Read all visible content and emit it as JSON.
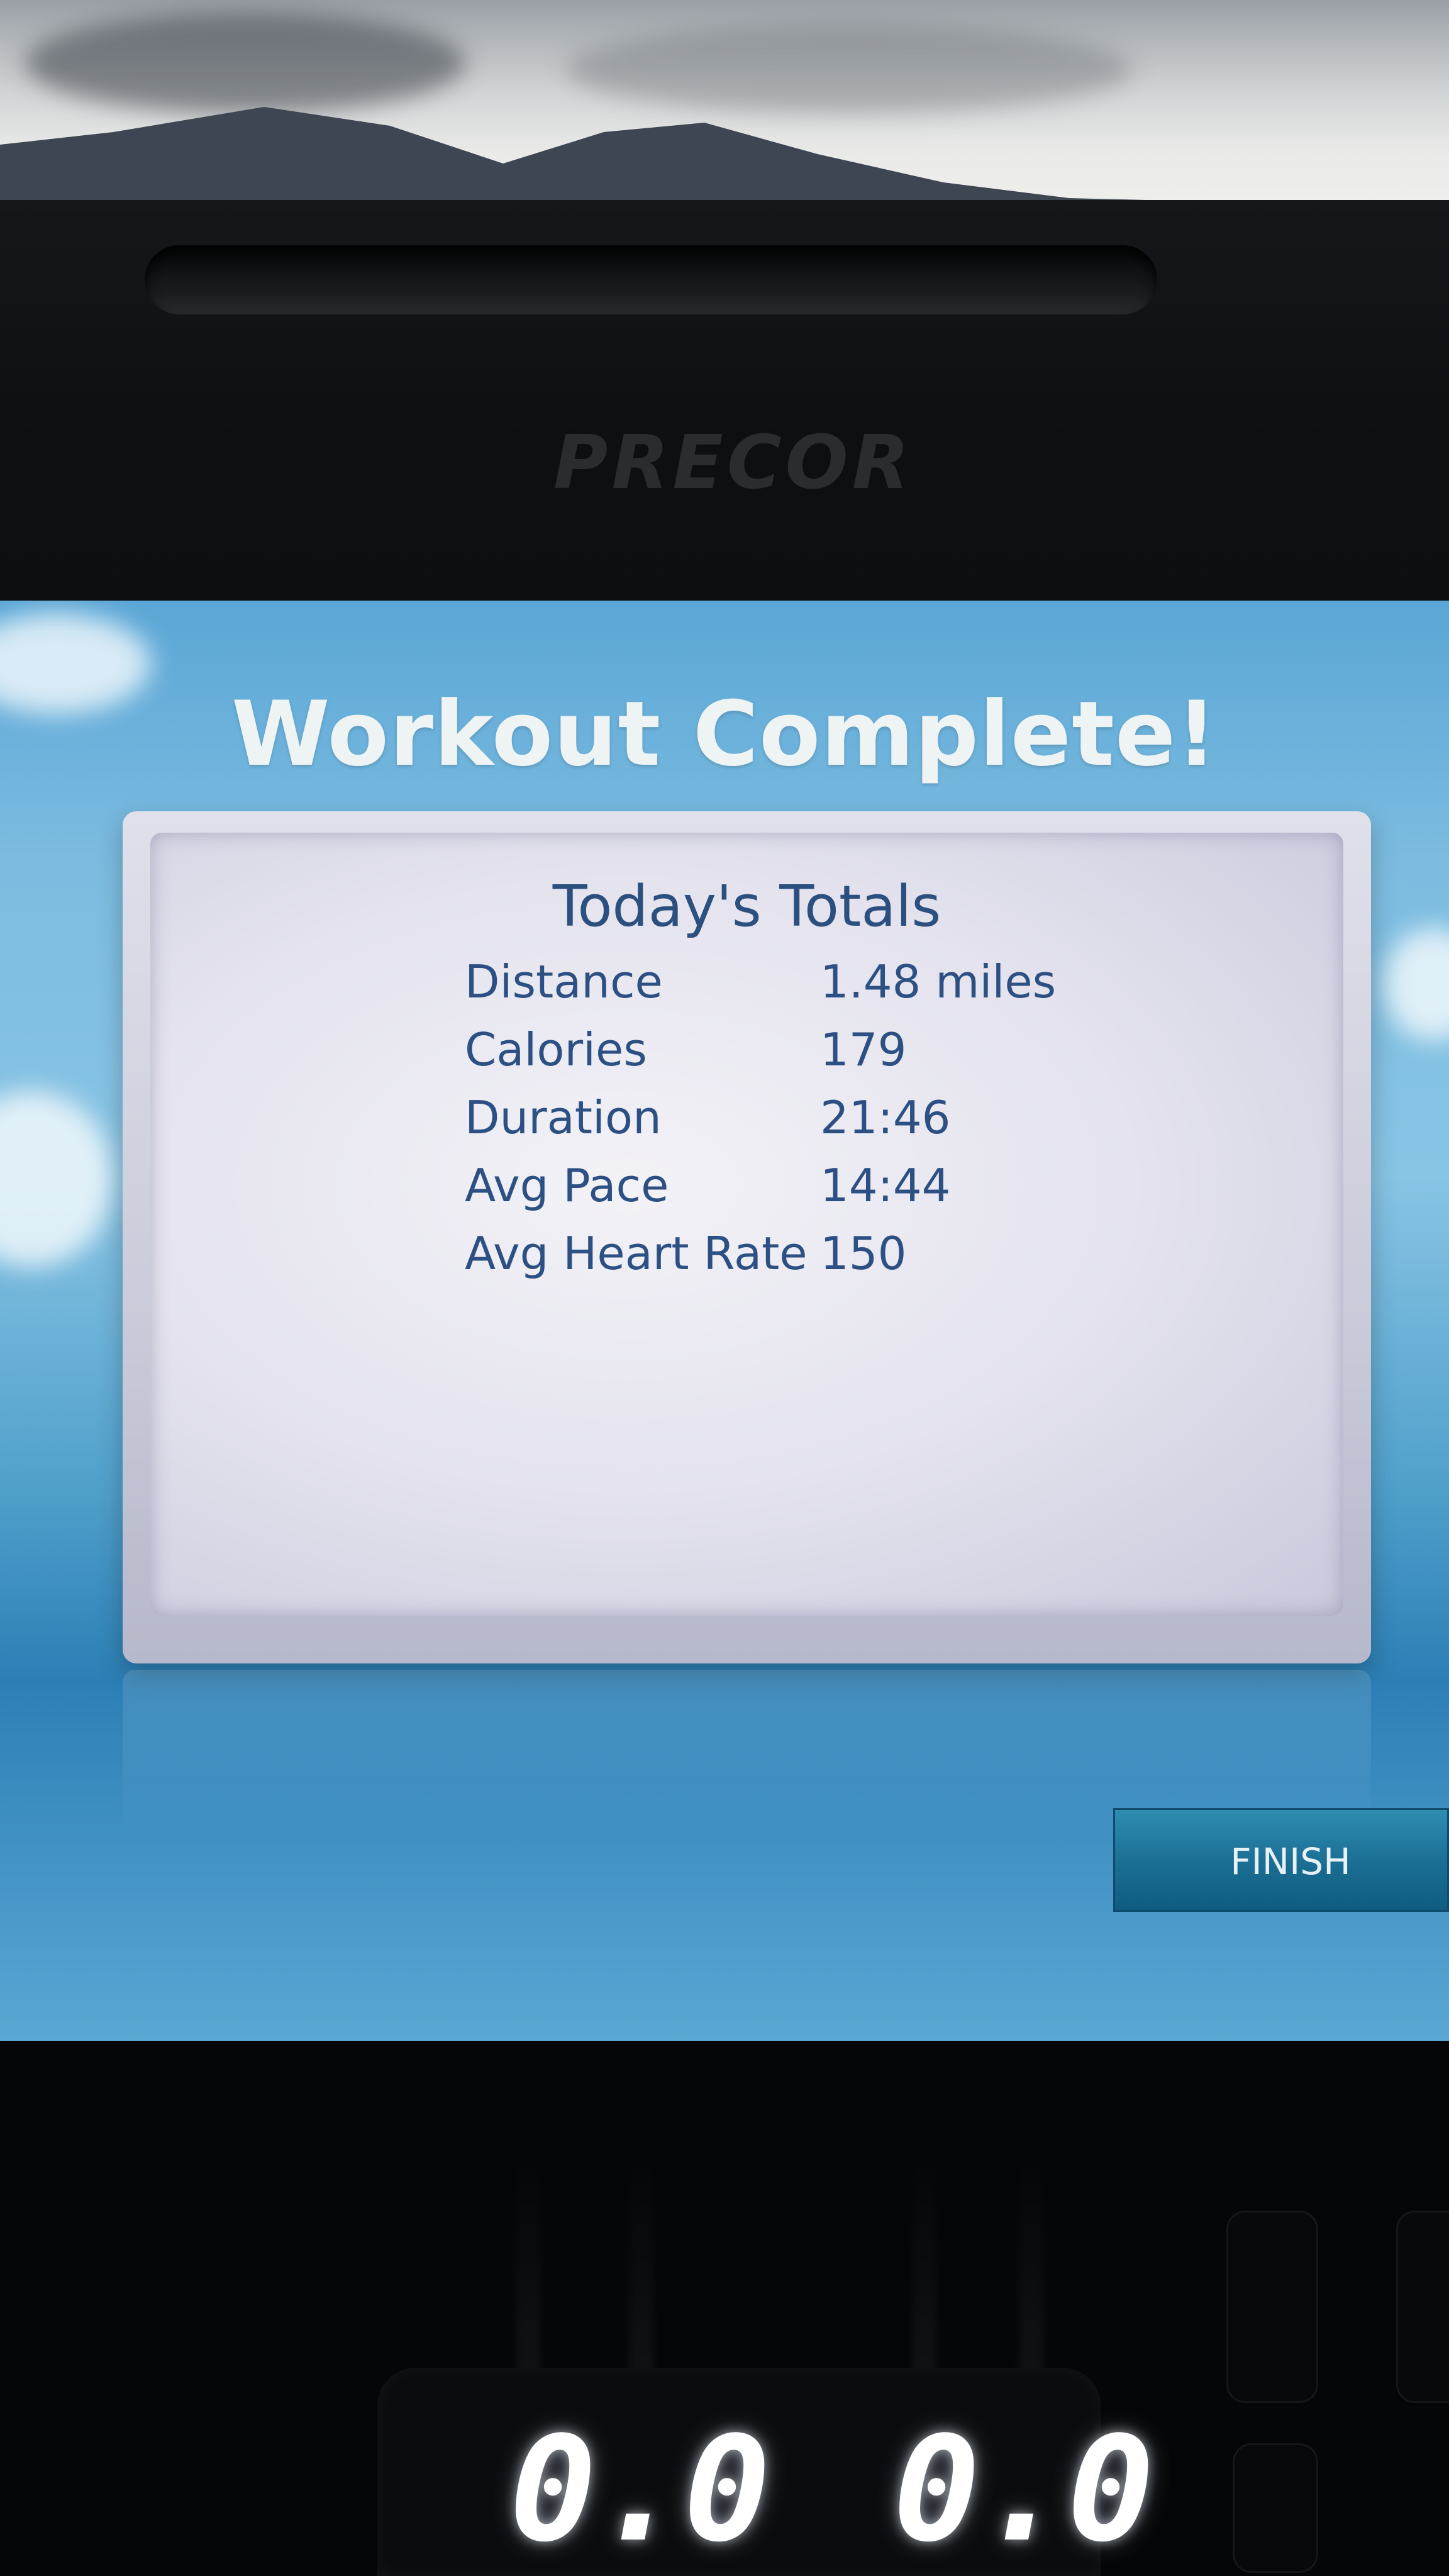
{
  "device": {
    "brand": "PRECOR"
  },
  "screen": {
    "title": "Workout Complete!",
    "summary_heading": "Today's Totals",
    "stats": [
      {
        "label": "Distance",
        "value": "1.48 miles"
      },
      {
        "label": "Calories",
        "value": "179"
      },
      {
        "label": "Duration",
        "value": "21:46"
      },
      {
        "label": "Avg Pace",
        "value": "14:44"
      },
      {
        "label": "Avg Heart Rate",
        "value": "150"
      }
    ],
    "finish_label": "FINISH"
  },
  "console": {
    "left_display": "0.0",
    "right_display": "0.0"
  },
  "colors": {
    "screen_blue": "#6bb3dd",
    "text_blue": "#2c5083",
    "button_teal": "#1a6d93"
  }
}
